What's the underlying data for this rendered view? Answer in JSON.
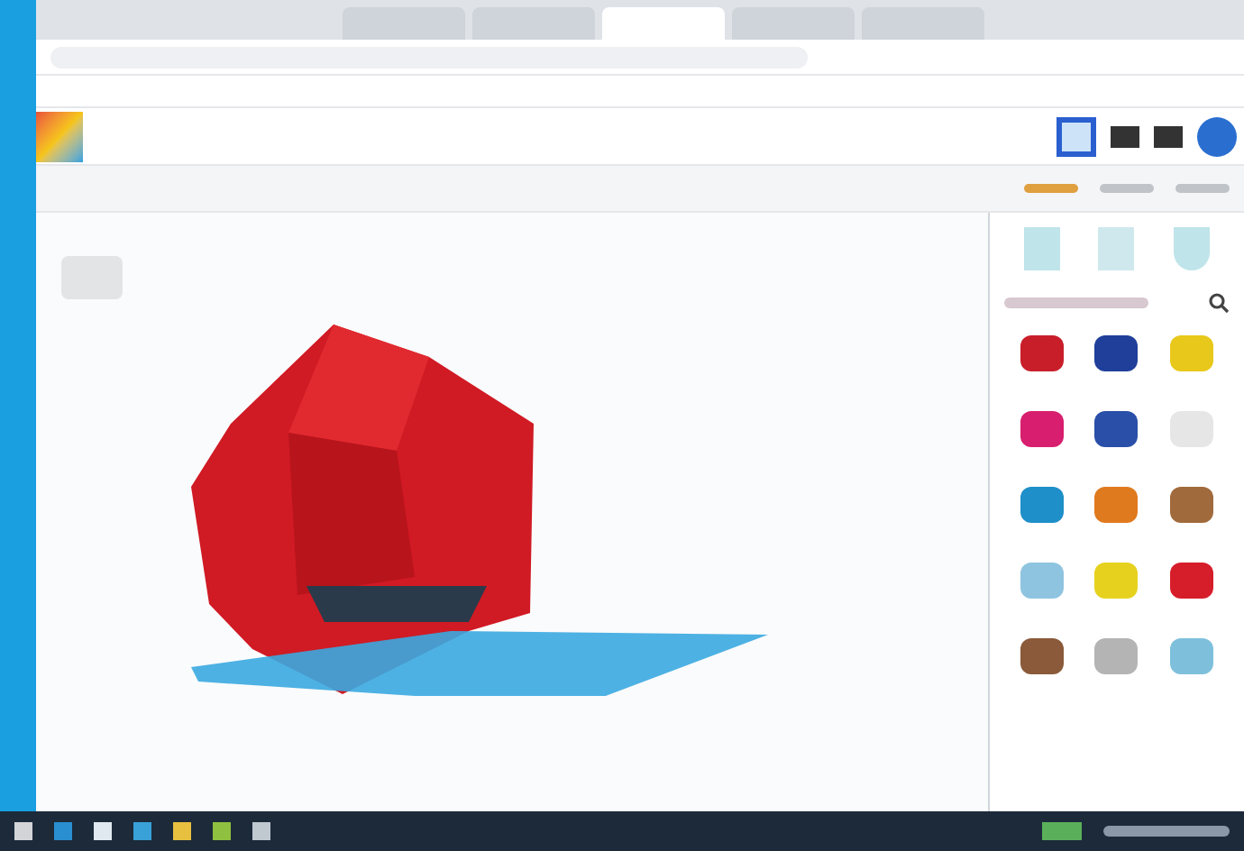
{
  "browser_tabs": [
    {
      "selected": false
    },
    {
      "selected": false
    },
    {
      "selected": true
    },
    {
      "selected": false
    },
    {
      "selected": false
    }
  ],
  "header_tools": [
    {
      "selected": true
    },
    {
      "selected": false
    },
    {
      "selected": false
    }
  ],
  "panel_tabs": [
    {
      "selected": true
    },
    {
      "selected": false
    },
    {
      "selected": false
    }
  ],
  "shapes": [
    {
      "color": "#c81e2a"
    },
    {
      "color": "#1f3f9a"
    },
    {
      "color": "#e8c81a"
    },
    {
      "color": "#d81e6e"
    },
    {
      "color": "#2a4fa8"
    },
    {
      "color": "#e6e6e6"
    },
    {
      "color": "#1e8fc8"
    },
    {
      "color": "#e07a1e"
    },
    {
      "color": "#a06a3c"
    },
    {
      "color": "#8fc4e0"
    },
    {
      "color": "#e6d21e"
    },
    {
      "color": "#d61e2a"
    },
    {
      "color": "#8a5a3a"
    },
    {
      "color": "#b4b4b4"
    },
    {
      "color": "#7ec0dc"
    }
  ]
}
